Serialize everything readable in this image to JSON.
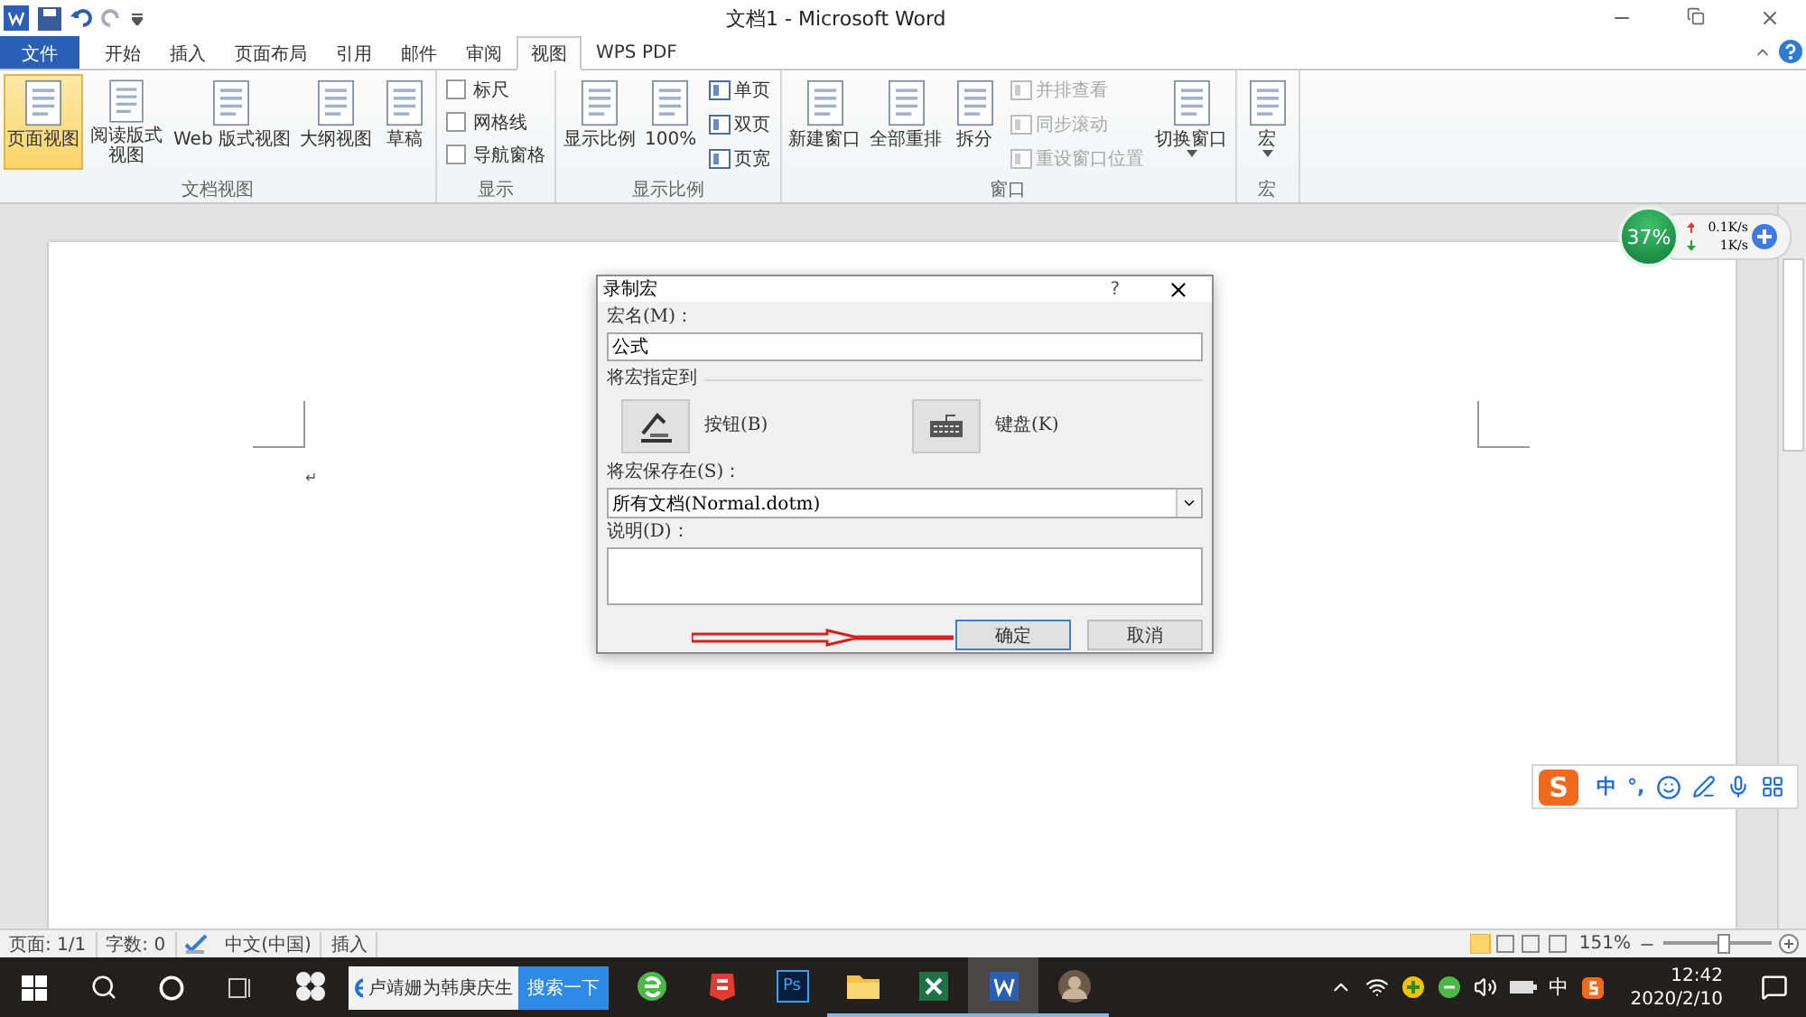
{
  "window": {
    "title": "文档1 - Microsoft Word"
  },
  "tabs": [
    {
      "label": "文件",
      "kind": "file",
      "selected": false
    },
    {
      "label": "开始",
      "kind": "tab",
      "selected": false
    },
    {
      "label": "插入",
      "kind": "tab",
      "selected": false
    },
    {
      "label": "页面布局",
      "kind": "tab",
      "selected": false
    },
    {
      "label": "引用",
      "kind": "tab",
      "selected": false
    },
    {
      "label": "邮件",
      "kind": "tab",
      "selected": false
    },
    {
      "label": "审阅",
      "kind": "tab",
      "selected": false
    },
    {
      "label": "视图",
      "kind": "tab",
      "selected": true
    },
    {
      "label": "WPS PDF",
      "kind": "tab",
      "selected": false
    }
  ],
  "ribbon": {
    "groups": [
      {
        "label": "文档视图",
        "items": [
          {
            "kind": "large",
            "label": "页面视图",
            "selected": true,
            "dropdown": false
          },
          {
            "kind": "large",
            "label": "阅读版式视图",
            "selected": false,
            "dropdown": false,
            "wrap": true
          },
          {
            "kind": "large",
            "label": "Web 版式视图",
            "selected": false,
            "dropdown": false
          },
          {
            "kind": "large",
            "label": "大纲视图",
            "selected": false,
            "dropdown": false
          },
          {
            "kind": "large",
            "label": "草稿",
            "selected": false,
            "dropdown": false
          }
        ]
      },
      {
        "label": "显示",
        "items": [
          {
            "kind": "check",
            "label": "标尺",
            "checked": false
          },
          {
            "kind": "check",
            "label": "网格线",
            "checked": false
          },
          {
            "kind": "check",
            "label": "导航窗格",
            "checked": false
          }
        ]
      },
      {
        "label": "显示比例",
        "items": [
          {
            "kind": "large",
            "label": "显示比例",
            "selected": false,
            "dropdown": false
          },
          {
            "kind": "large",
            "label": "100%",
            "selected": false,
            "dropdown": false
          },
          {
            "kind": "small",
            "label": "单页",
            "disabled": false
          },
          {
            "kind": "small",
            "label": "双页",
            "disabled": false
          },
          {
            "kind": "small",
            "label": "页宽",
            "disabled": false
          }
        ]
      },
      {
        "label": "窗口",
        "items": [
          {
            "kind": "large",
            "label": "新建窗口",
            "selected": false,
            "dropdown": false
          },
          {
            "kind": "large",
            "label": "全部重排",
            "selected": false,
            "dropdown": false
          },
          {
            "kind": "large",
            "label": "拆分",
            "selected": false,
            "dropdown": false
          },
          {
            "kind": "small",
            "label": "并排查看",
            "disabled": true
          },
          {
            "kind": "small",
            "label": "同步滚动",
            "disabled": true
          },
          {
            "kind": "small",
            "label": "重设窗口位置",
            "disabled": true
          },
          {
            "kind": "large",
            "label": "切换窗口",
            "selected": false,
            "dropdown": true
          }
        ]
      },
      {
        "label": "宏",
        "items": [
          {
            "kind": "large",
            "label": "宏",
            "selected": false,
            "dropdown": true
          }
        ]
      }
    ]
  },
  "document": {
    "paragraph_mark": "↵"
  },
  "dialog": {
    "title": "录制宏",
    "help": "?",
    "name_label": "宏名(M)：",
    "name_value": "公式",
    "assign_label": "将宏指定到",
    "assign_buttons": [
      {
        "kind": "button",
        "label": "按钮(B)"
      },
      {
        "kind": "keyboard",
        "label": "键盘(K)"
      }
    ],
    "store_label": "将宏保存在(S)：",
    "store_value": "所有文档(Normal.dotm)",
    "description_label": "说明(D)：",
    "buttons": [
      {
        "label": "确定",
        "selected": true
      },
      {
        "label": "取消",
        "selected": false
      }
    ]
  },
  "network_widget": {
    "percent": "37%",
    "upload": "0.1K/s",
    "download": "1K/s"
  },
  "ime_bar": {
    "logo": "S",
    "mode": "中",
    "punctuation": "°,"
  },
  "status_bar": {
    "page": "页面: 1/1",
    "words": "字数: 0",
    "language": "中文(中国)",
    "mode": "插入",
    "zoom": "151%",
    "zoom_slider": {
      "level": 0.55
    }
  },
  "taskbar": {
    "search_text": "卢靖姗为韩庚庆生",
    "search_button": "搜索一下",
    "ps_label": "Ps",
    "apps": [
      {
        "kind": "pinwheel",
        "running": false,
        "selected": false
      },
      {
        "kind": "browser",
        "running": false,
        "selected": false
      },
      {
        "kind": "wps",
        "running": false,
        "selected": false
      },
      {
        "kind": "photoshop",
        "running": false,
        "selected": false
      },
      {
        "kind": "folder",
        "running": true,
        "selected": false
      },
      {
        "kind": "excel",
        "running": true,
        "selected": false
      },
      {
        "kind": "word",
        "running": true,
        "selected": true
      },
      {
        "kind": "avatar",
        "running": true,
        "selected": false
      }
    ],
    "tray": {
      "ime": "中",
      "time": "12:42",
      "date": "2020/2/10"
    }
  }
}
